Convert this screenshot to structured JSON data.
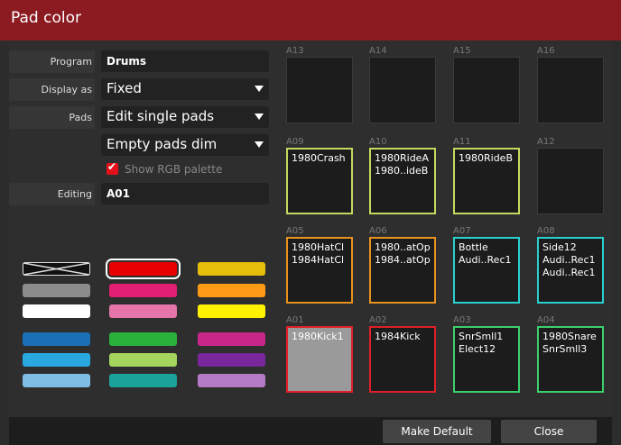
{
  "window": {
    "title": "Pad color"
  },
  "form": {
    "program_label": "Program",
    "program_value": "Drums",
    "display_label": "Display as",
    "display_value": "Fixed",
    "pads_label": "Pads",
    "pads_value": "Edit single pads",
    "empty_value": "Empty pads dim",
    "checkbox_label": "Show RGB palette",
    "checkbox_checked": true,
    "editing_label": "Editing",
    "editing_value": "A01"
  },
  "swatches": [
    {
      "color": "none"
    },
    {
      "color": "#e80000",
      "selected": true
    },
    {
      "color": "#e7bd0c"
    },
    {
      "color": "#8c8c8c"
    },
    {
      "color": "#e21f73"
    },
    {
      "color": "#ff9a16"
    },
    {
      "color": "#ffffff"
    },
    {
      "color": "#e676a9"
    },
    {
      "color": "#fff200"
    },
    {
      "color": "#1a6fb5"
    },
    {
      "color": "#2ab13c"
    },
    {
      "color": "#c9268a"
    },
    {
      "color": "#29a8e0"
    },
    {
      "color": "#a4d65e"
    },
    {
      "color": "#79279b"
    },
    {
      "color": "#7fbde4"
    },
    {
      "color": "#1aa39b"
    },
    {
      "color": "#b57ac5"
    }
  ],
  "pads": [
    {
      "id": "A13",
      "lines": [],
      "color": ""
    },
    {
      "id": "A14",
      "lines": [],
      "color": ""
    },
    {
      "id": "A15",
      "lines": [],
      "color": ""
    },
    {
      "id": "A16",
      "lines": [],
      "color": ""
    },
    {
      "id": "A09",
      "lines": [
        "1980Crash"
      ],
      "color": "#c4d95e"
    },
    {
      "id": "A10",
      "lines": [
        "1980RideA",
        "1980..ideB"
      ],
      "color": "#c4d95e"
    },
    {
      "id": "A11",
      "lines": [
        "1980RideB"
      ],
      "color": "#c4d95e"
    },
    {
      "id": "A12",
      "lines": [],
      "color": ""
    },
    {
      "id": "A05",
      "lines": [
        "1980HatCl",
        "1984HatCl"
      ],
      "color": "#e8921f"
    },
    {
      "id": "A06",
      "lines": [
        "1980..atOp",
        "1984..atOp"
      ],
      "color": "#e8921f"
    },
    {
      "id": "A07",
      "lines": [
        "Bottle",
        "Audi..Rec1"
      ],
      "color": "#29d0d0"
    },
    {
      "id": "A08",
      "lines": [
        "Side12",
        "Audi..Rec1",
        "Audi..Rec1"
      ],
      "color": "#29d0d0"
    },
    {
      "id": "A01",
      "lines": [
        "1980Kick1"
      ],
      "color": "#e11f2a",
      "fill": "#9a9a9a"
    },
    {
      "id": "A02",
      "lines": [
        "1984Kick"
      ],
      "color": "#e11f2a"
    },
    {
      "id": "A03",
      "lines": [
        "SnrSmll1",
        "Elect12"
      ],
      "color": "#3bd06e"
    },
    {
      "id": "A04",
      "lines": [
        "1980Snare",
        "SnrSmll3"
      ],
      "color": "#3bd06e"
    }
  ],
  "buttons": {
    "make_default": "Make Default",
    "close": "Close"
  }
}
